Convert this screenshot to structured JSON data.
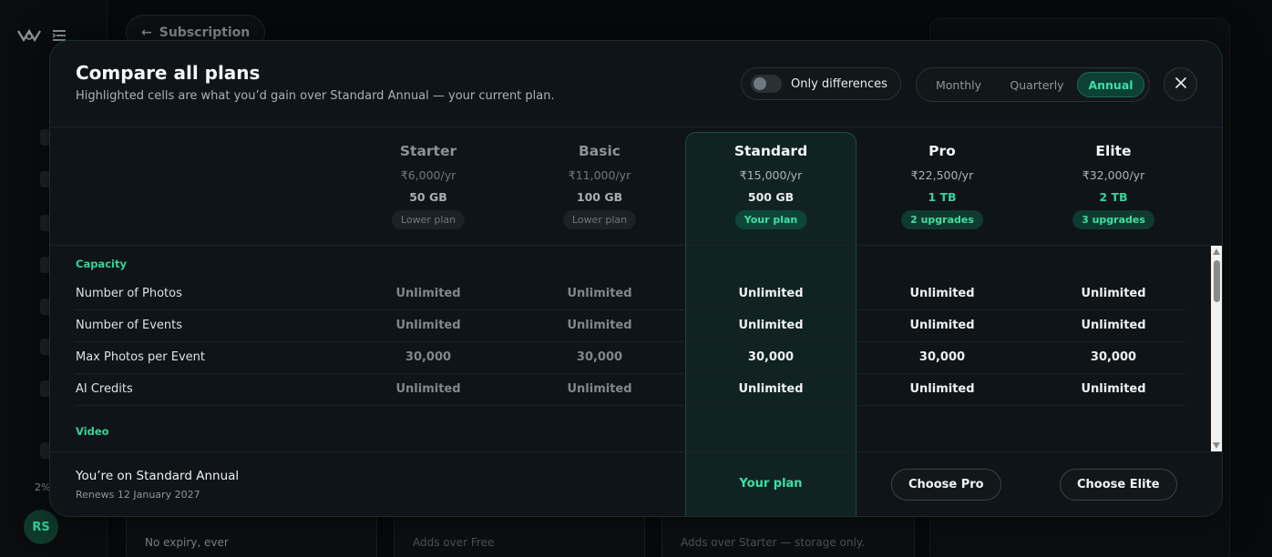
{
  "background": {
    "back_label": "Subscription",
    "percent": "2%",
    "avatar_initials": "RS",
    "card_text_1": "No expiry, ever",
    "card_text_2": "Adds over Free",
    "card_text_3": "Adds over Starter — storage only."
  },
  "modal": {
    "title": "Compare all plans",
    "subtitle": "Highlighted cells are what you’d gain over Standard Annual — your current plan.",
    "diff_toggle_label": "Only differences",
    "periods": [
      "Monthly",
      "Quarterly",
      "Annual"
    ],
    "active_period": "Annual",
    "close_icon": "×"
  },
  "plans": [
    {
      "name": "Starter",
      "price": "₹6,000/yr",
      "storage": "50 GB",
      "pill": "Lower plan"
    },
    {
      "name": "Basic",
      "price": "₹11,000/yr",
      "storage": "100 GB",
      "pill": "Lower plan"
    },
    {
      "name": "Standard",
      "price": "₹15,000/yr",
      "storage": "500 GB",
      "pill": "Your plan"
    },
    {
      "name": "Pro",
      "price": "₹22,500/yr",
      "storage": "1 TB",
      "pill": "2 upgrades"
    },
    {
      "name": "Elite",
      "price": "₹32,000/yr",
      "storage": "2 TB",
      "pill": "3 upgrades"
    }
  ],
  "sections": [
    {
      "label": "Capacity",
      "rows": [
        {
          "label": "Number of Photos",
          "values": [
            "Unlimited",
            "Unlimited",
            "Unlimited",
            "Unlimited",
            "Unlimited"
          ]
        },
        {
          "label": "Number of Events",
          "values": [
            "Unlimited",
            "Unlimited",
            "Unlimited",
            "Unlimited",
            "Unlimited"
          ]
        },
        {
          "label": "Max Photos per Event",
          "values": [
            "30,000",
            "30,000",
            "30,000",
            "30,000",
            "30,000"
          ]
        },
        {
          "label": "AI Credits",
          "values": [
            "Unlimited",
            "Unlimited",
            "Unlimited",
            "Unlimited",
            "Unlimited"
          ]
        }
      ]
    },
    {
      "label": "Video",
      "rows": []
    }
  ],
  "footer": {
    "title": "You’re on Standard Annual",
    "subtitle": "Renews 12 January 2027",
    "current_label": "Your plan",
    "choose_pro": "Choose Pro",
    "choose_elite": "Choose Elite"
  },
  "colors": {
    "accent": "#3fe0a5",
    "modal_bg": "#0f1418",
    "current_band": "#144a3e"
  }
}
